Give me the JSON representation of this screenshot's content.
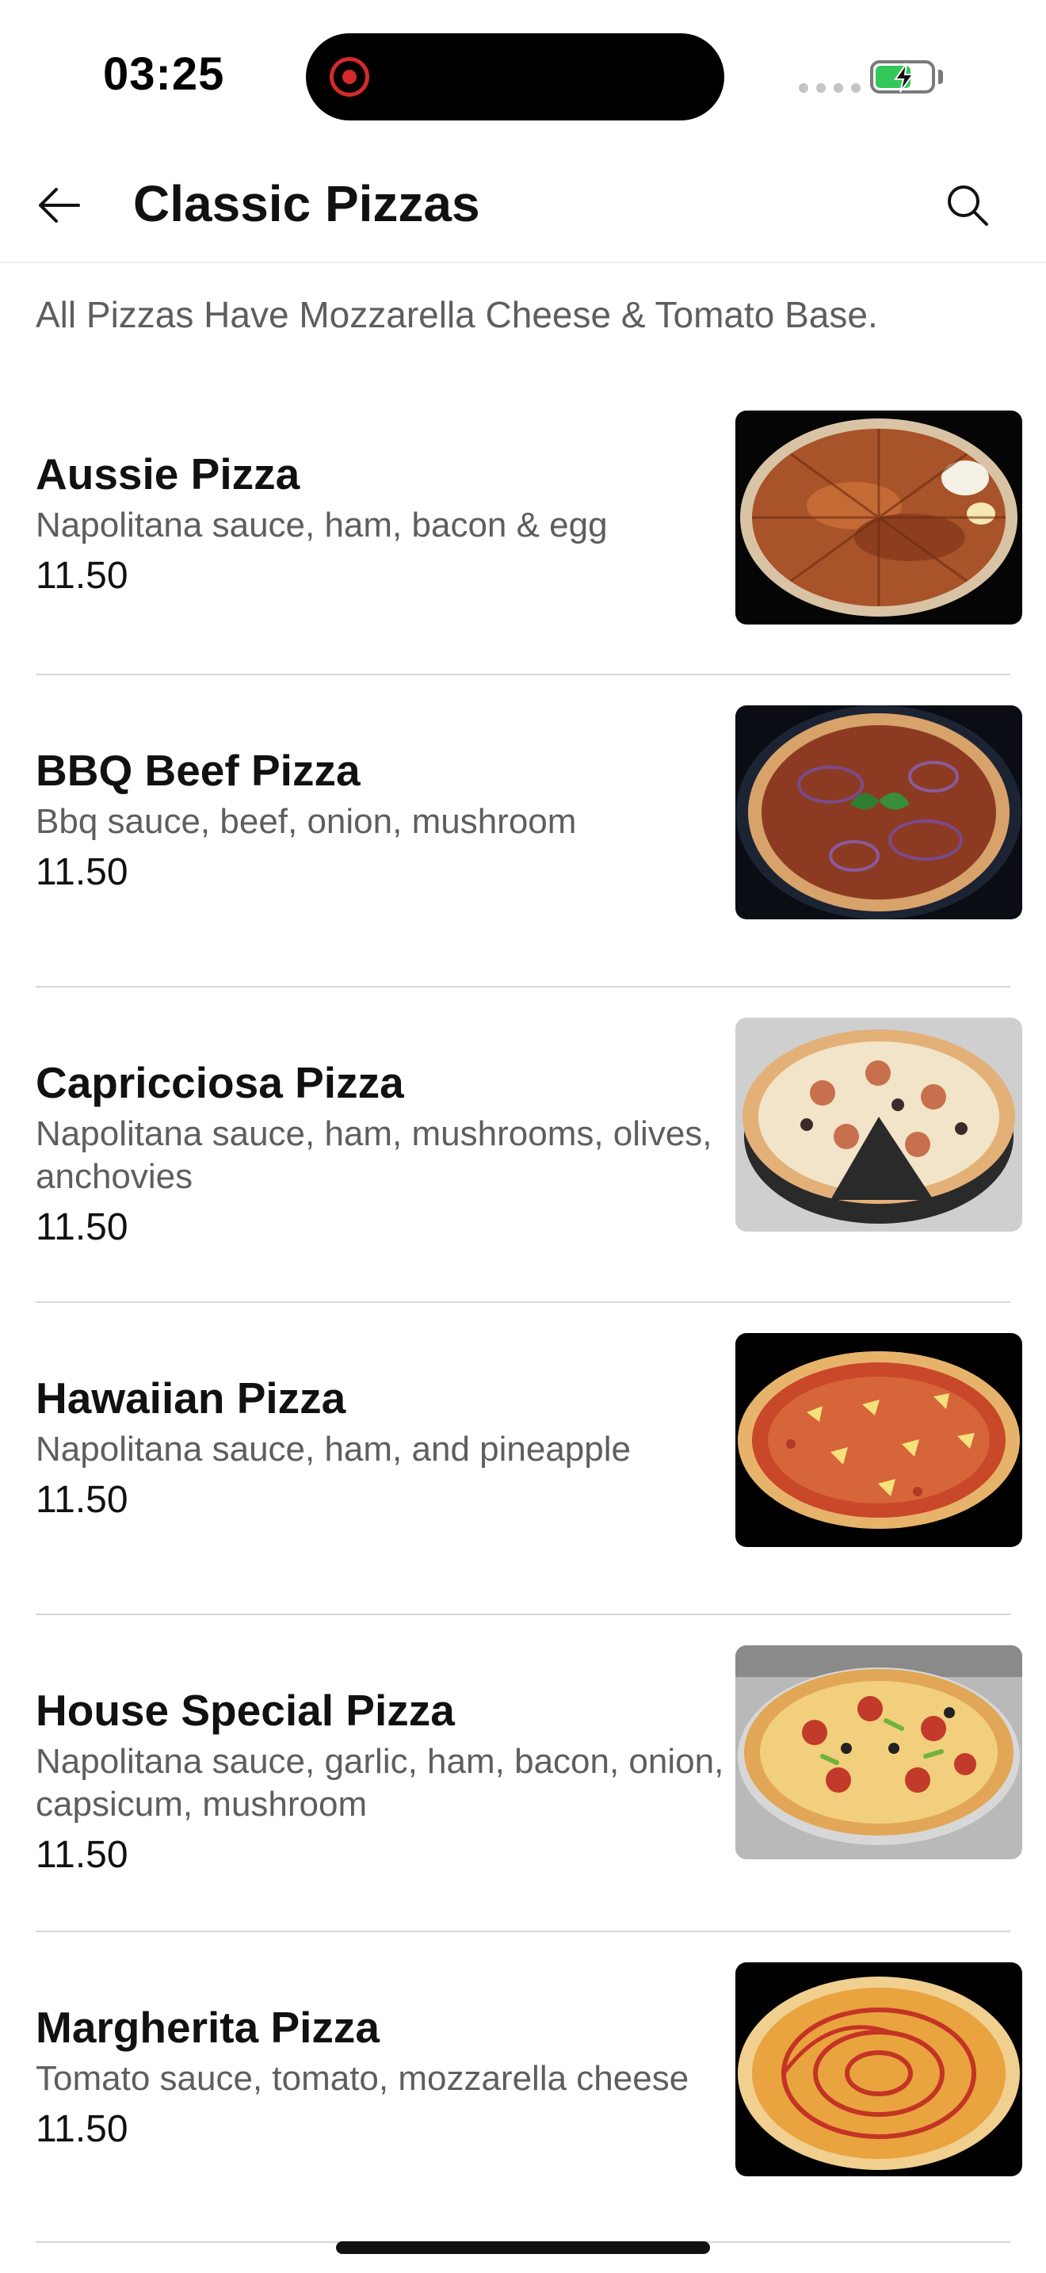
{
  "status_bar": {
    "time": "03:25",
    "battery_level": 0.65,
    "battery_color": "#34c759",
    "recording_color": "#d42a2a"
  },
  "header": {
    "title": "Classic Pizzas",
    "back_icon": "arrow-left-icon",
    "search_icon": "search-icon"
  },
  "category_note": "All Pizzas Have Mozzarella Cheese & Tomato Base.",
  "items": [
    {
      "name": "Aussie Pizza",
      "description": "Napolitana sauce, ham, bacon & egg",
      "price": "11.50"
    },
    {
      "name": "BBQ Beef Pizza",
      "description": "Bbq sauce, beef, onion, mushroom",
      "price": "11.50"
    },
    {
      "name": "Capricciosa Pizza",
      "description": "Napolitana sauce, ham, mushrooms, olives, anchovies",
      "price": "11.50"
    },
    {
      "name": "Hawaiian Pizza",
      "description": "Napolitana sauce, ham, and pineapple",
      "price": "11.50"
    },
    {
      "name": "House Special Pizza",
      "description": "Napolitana sauce, garlic, ham, bacon, onion, capsicum, mushroom",
      "price": "11.50"
    },
    {
      "name": "Margherita Pizza",
      "description": "Tomato sauce, tomato, mozzarella cheese",
      "price": "11.50"
    }
  ]
}
